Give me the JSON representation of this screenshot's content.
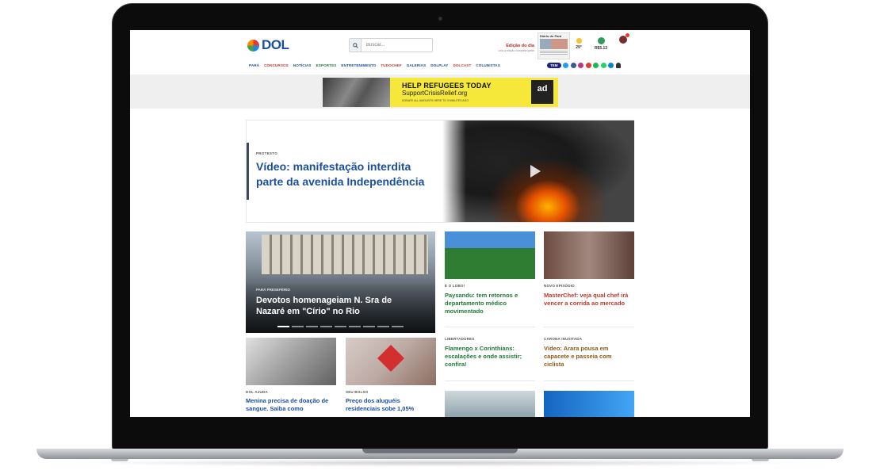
{
  "header": {
    "logo_text": "DOL",
    "search_icon": "search-icon",
    "search_placeholder": "Buscar...",
    "edition_title": "Edição do dia",
    "edition_sub": "Leia a edição completa grátis",
    "paper_head": "Diário do Pará",
    "weather_temp": "29°",
    "currency": "R$5.13",
    "tem_label": "TEM"
  },
  "menu": [
    {
      "label": "PARÁ",
      "color": "#1a4f9c"
    },
    {
      "label": "CONCURSOS",
      "color": "#c0392b"
    },
    {
      "label": "NOTÍCIAS",
      "color": "#1a4f9c"
    },
    {
      "label": "ESPORTES",
      "color": "#1f7a34"
    },
    {
      "label": "ENTRETENIMENTO",
      "color": "#1a4f9c"
    },
    {
      "label": "TUDOCHEF",
      "color": "#c0392b"
    },
    {
      "label": "GALERIAS",
      "color": "#1a4f9c"
    },
    {
      "label": "DOLPLAY",
      "color": "#1a4f9c"
    },
    {
      "label": "DOLCAST",
      "color": "#c0392b"
    },
    {
      "label": "COLUNISTAS",
      "color": "#1a4f9c"
    }
  ],
  "social": [
    {
      "name": "twitter-icon",
      "color": "#1da1f2"
    },
    {
      "name": "facebook-icon",
      "color": "#3b5998"
    },
    {
      "name": "instagram-icon",
      "color": "#c13584"
    },
    {
      "name": "youtube-icon",
      "color": "#e53935"
    },
    {
      "name": "spotify-icon",
      "color": "#1db954"
    },
    {
      "name": "whatsapp-icon",
      "color": "#25d366"
    },
    {
      "name": "telegram-icon",
      "color": "#0088cc"
    }
  ],
  "ad": {
    "headline": "HELP REFUGEES TODAY",
    "url": "SupportCrisisRelief.org",
    "note": "DONATE ALL AMOUNTS HERE TO 3 MINUTES AGO",
    "badge": "ad"
  },
  "hero": {
    "kicker": "PROTESTO",
    "title": "Vídeo: manifestação interdita parte da avenida Independência"
  },
  "big_card": {
    "kicker": "PARÁ PRESEPÉRIO",
    "title": "Devotos homenageiam N. Sra de Nazaré em \"Círio\" no Rio"
  },
  "cards": [
    {
      "kicker": "É O LOBO!",
      "title": "Paysandu: tem retornos e departamento médico movimentado",
      "color": "green"
    },
    {
      "kicker": "NOVO EPISÓDIO",
      "title": "MasterChef: veja qual chef irá vencer a corrida ao mercado",
      "color": "red"
    },
    {
      "kicker": "LIBERTADORES",
      "title": "Flamengo x Corinthians: escalações e onde assistir; confira!",
      "color": "green"
    },
    {
      "kicker": "CARONA INUSITADA",
      "title": "Vídeo: Arara pousa em capacete e passeia com ciclista",
      "color": "brown"
    },
    {
      "kicker": "DOL AJUDA",
      "title": "Menina precisa de doação de sangue. Saiba como",
      "color": "blue"
    },
    {
      "kicker": "SEU BOLSO",
      "title": "Preço dos aluguéis residenciais sobe 1,05%",
      "color": "blue"
    }
  ]
}
